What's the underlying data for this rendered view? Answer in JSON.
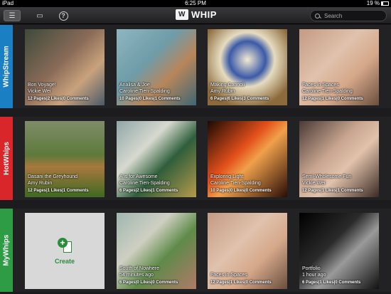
{
  "status": {
    "carrier": "iPad",
    "time": "6:25 PM",
    "battery": "19 %"
  },
  "app": {
    "logo_mark": "W",
    "name": "WHIP"
  },
  "toolbar": {
    "help_glyph": "?",
    "list_glyph": "☰",
    "comment_glyph": "▭"
  },
  "search": {
    "placeholder": "Search"
  },
  "sections": [
    {
      "label": "WhipStream",
      "color": "#1b7fc4",
      "tiles": [
        {
          "title": "Bon Voyage!",
          "author": "Vickie Wei",
          "stats": "12 Pages|2 Likes|0 Comments",
          "bg": "linear-gradient(135deg,#3d4a3a,#8a6b58 45%,#c9a27d 70%,#4c5a68)"
        },
        {
          "title": "Analisa & Joe",
          "author": "Caroline Tien-Spalding",
          "stats": "10 Pages|0 Likes|1 Comments",
          "bg": "linear-gradient(135deg,#8fb6c0,#6e9ca8 40%,#b7865a 65%,#3f6673)"
        },
        {
          "title": "Making Cannoli",
          "author": "Amy Rubin",
          "stats": "6 Pages|6 Likes|3 Comments",
          "bg": "radial-gradient(circle at 50% 40%,#f2ead2 0,#3b5aa8 30%,#e6dcc0 45%,#8c6a3c 80%)"
        },
        {
          "title": "Faces in Spaces",
          "author": "Caroline Tien-Spalding",
          "stats": "12 Pages|1 Likes|0 Comments",
          "bg": "linear-gradient(135deg,#c49a82,#e0c2ad 40%,#d6a88a 65%,#6a4e3e)"
        }
      ]
    },
    {
      "label": "HotWhips",
      "color": "#d9262b",
      "tiles": [
        {
          "title": "Dasani the Greyhound",
          "author": "Amy Rubin",
          "stats": "12 Pages|1 Likes|1 Comments",
          "bg": "linear-gradient(180deg,#7f8c6a,#5d7a3a 45%,#a8783e 60%,#3e6a22)"
        },
        {
          "title": "A is for Awesome",
          "author": "Caroline Tien-Spalding",
          "stats": "6 Pages|2 Likes|1 Comments",
          "bg": "linear-gradient(135deg,#8fa6a8,#d7d9cf 35%,#2f5e3b 60%,#b59a4c)"
        },
        {
          "title": "Exploring Light",
          "author": "Caroline Tien-Spalding",
          "stats": "10 Pages|0 Likes|0 Comments",
          "bg": "linear-gradient(135deg,#1a0a05,#e3501b 40%,#f0a04b 55%,#2a0d06)"
        },
        {
          "title": "Semi-Wholesome Fun",
          "author": "Vickie Wei",
          "stats": "12 Pages|1 Likes|1 Comments",
          "bg": "linear-gradient(135deg,#4a3a36,#c8a590 40%,#e1c2ab 60%,#3a2a24)"
        }
      ]
    },
    {
      "label": "MyWhips",
      "color": "#2e9b45",
      "tiles": [
        {
          "create": true,
          "label": "Create"
        },
        {
          "title": "South of Nowhere",
          "time": "54 minutes ago",
          "stats": "6 Pages|0 Likes|0 Comments",
          "bg": "linear-gradient(135deg,#9fb7b0,#cfcfc2 35%,#5f8a4a 60%,#b07a68)"
        },
        {
          "title": "Faces in Spaces",
          "time": "",
          "stats": "12 Pages|1 Likes|0 Comments",
          "bg": "linear-gradient(135deg,#c49a82,#e0c2ad 40%,#d6a88a 65%,#6a4e3e)"
        },
        {
          "title": "Portfolio",
          "time": "1 hour ago",
          "stats": "6 Pages|1 Likes|0 Comments",
          "bg": "linear-gradient(135deg,#000,#2a2a2a 40%,#9a9a9a 60%,#111)"
        }
      ]
    }
  ]
}
